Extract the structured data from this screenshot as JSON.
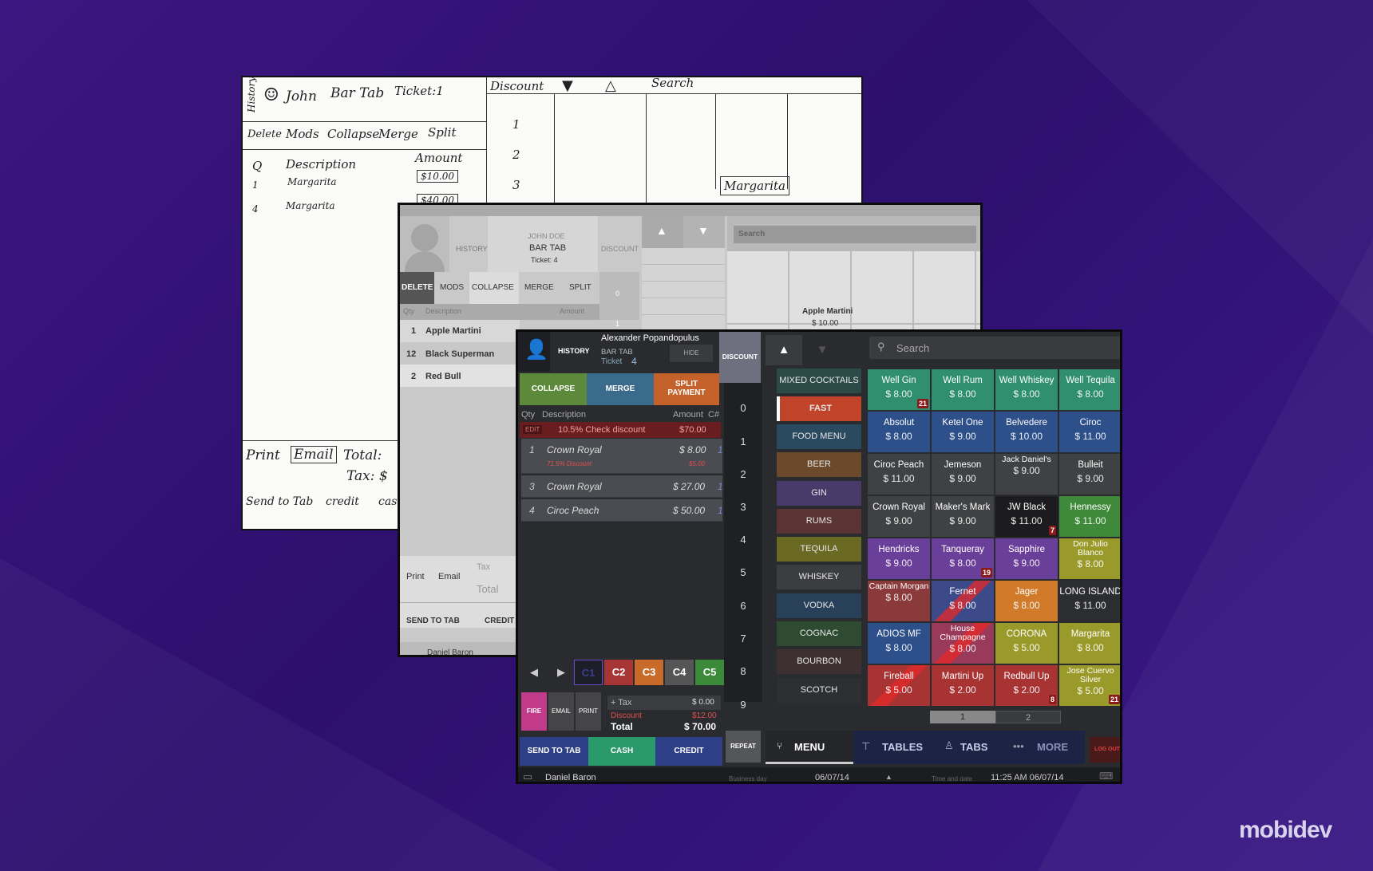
{
  "sketch": {
    "history": "History",
    "name": "John",
    "bar_tab": "Bar Tab",
    "ticket": "Ticket:1",
    "discount": "Discount",
    "search": "Search",
    "tabs": [
      "Delete",
      "Mods",
      "Collapse",
      "Merge",
      "Split"
    ],
    "col_q": "Q",
    "col_desc": "Description",
    "col_amount": "Amount",
    "rows": [
      {
        "q": "1",
        "desc": "Margarita",
        "amount": "$10.00"
      },
      {
        "q": "4",
        "desc": "Margarita",
        "amount": "$40.00"
      }
    ],
    "nums": [
      "1",
      "2",
      "3"
    ],
    "tile": "Margarita",
    "print": "Print",
    "email": "Email",
    "total": "Total:",
    "tax": "Tax: $",
    "send": "Send to Tab",
    "credit": "credit",
    "cash": "cas"
  },
  "wire": {
    "history": "HISTORY",
    "name": "JOHN DOE",
    "bar_tab": "BAR TAB",
    "ticket": "Ticket: 4",
    "discount": "DISCOUNT",
    "search": "Search",
    "tabs": [
      "DELETE",
      "MODS",
      "COLLAPSE",
      "MERGE",
      "SPLIT"
    ],
    "col_qty": "Qty",
    "col_desc": "Description",
    "col_amount": "Amount",
    "rows": [
      {
        "q": "1",
        "d": "Apple Martini"
      },
      {
        "q": "12",
        "d": "Black Superman"
      },
      {
        "q": "2",
        "d": "Red Bull"
      }
    ],
    "nums": [
      "0",
      "1"
    ],
    "tile_name": "Apple Martini",
    "tile_price": "$ 10.00",
    "print": "Print",
    "email": "Email",
    "tax": "Tax",
    "total": "Total",
    "send": "SEND TO TAB",
    "credit": "CREDIT",
    "user": "Daniel Baron"
  },
  "pos": {
    "history": "HISTORY",
    "customer": "Alexander Popandopulus",
    "bar_tab": "BAR TAB",
    "ticket_label": "Ticket",
    "ticket_num": "4",
    "hide": "HIDE",
    "discount": "DISCOUNT",
    "collapse": "COLLAPSE",
    "merge": "MERGE",
    "split": "SPLIT PAYMENT",
    "col_qty": "Qty",
    "col_desc": "Description",
    "col_amount": "Amount",
    "col_c": "C#",
    "disc_edit": "EDIT",
    "disc_text": "10.5%  Check discount",
    "disc_amount": "$70.00",
    "orders": [
      {
        "q": "1",
        "d": "Crown Royal",
        "a": "$ 8.00",
        "c": "1",
        "sub": "71.5%   Discount",
        "sub_a": "$5.00"
      },
      {
        "q": "3",
        "d": "Crown Royal",
        "a": "$ 27.00",
        "c": "1"
      },
      {
        "q": "4",
        "d": "Ciroc Peach",
        "a": "$ 50.00",
        "c": "1"
      }
    ],
    "nums": [
      "0",
      "1",
      "2",
      "3",
      "4",
      "5",
      "6",
      "7",
      "8",
      "9"
    ],
    "checks": [
      "C1",
      "C2",
      "C3",
      "C4",
      "C5"
    ],
    "fire": "FIRE",
    "email": "EMAIL",
    "print": "PRINT",
    "tax": "+ Tax",
    "tax_v": "$ 0.00",
    "discount_l": "Discount",
    "discount_v": "$12.00",
    "total": "Total",
    "total_v": "$ 70.00",
    "send": "SEND TO TAB",
    "cash": "CASH",
    "credit": "CREDIT",
    "repeat": "REPEAT",
    "search": "Search",
    "categories": [
      "MIXED COCKTAILS",
      "FAST",
      "FOOD MENU",
      "BEER",
      "GIN",
      "RUMS",
      "TEQUILA",
      "WHISKEY",
      "VODKA",
      "COGNAC",
      "BOURBON",
      "SCOTCH"
    ],
    "items": [
      {
        "n": "Well Gin",
        "p": "$ 8.00",
        "b": "21"
      },
      {
        "n": "Well Rum",
        "p": "$ 8.00"
      },
      {
        "n": "Well Whiskey",
        "p": "$ 8.00"
      },
      {
        "n": "Well Tequila",
        "p": "$ 8.00"
      },
      {
        "n": "Absolut",
        "p": "$ 8.00"
      },
      {
        "n": "Ketel One",
        "p": "$ 9.00"
      },
      {
        "n": "Belvedere",
        "p": "$ 10.00"
      },
      {
        "n": "Ciroc",
        "p": "$ 11.00"
      },
      {
        "n": "Ciroc Peach",
        "p": "$ 11.00"
      },
      {
        "n": "Jemeson",
        "p": "$ 9.00"
      },
      {
        "n": "Jack Daniel's",
        "p": "$ 9.00"
      },
      {
        "n": "Bulleit",
        "p": "$ 9.00"
      },
      {
        "n": "Crown Royal",
        "p": "$ 9.00"
      },
      {
        "n": "Maker's Mark",
        "p": "$ 9.00"
      },
      {
        "n": "JW Black",
        "p": "$ 11.00",
        "b": "7"
      },
      {
        "n": "Hennessy",
        "p": "$ 11.00"
      },
      {
        "n": "Hendricks",
        "p": "$ 9.00"
      },
      {
        "n": "Tanqueray",
        "p": "$ 8.00",
        "b": "19"
      },
      {
        "n": "Sapphire",
        "p": "$ 9.00"
      },
      {
        "n": "Don Julio Blanco",
        "p": "$ 8.00"
      },
      {
        "n": "Captain Morgan",
        "p": "$ 8.00"
      },
      {
        "n": "Fernet",
        "p": "$ 8.00"
      },
      {
        "n": "Jager",
        "p": "$ 8.00"
      },
      {
        "n": "LONG ISLAND",
        "p": "$ 11.00"
      },
      {
        "n": "ADIOS MF",
        "p": "$ 8.00"
      },
      {
        "n": "House Champagne",
        "p": "$ 8.00"
      },
      {
        "n": "CORONA",
        "p": "$ 5.00"
      },
      {
        "n": "Margarita",
        "p": "$ 8.00"
      },
      {
        "n": "Fireball",
        "p": "$ 5.00"
      },
      {
        "n": "Martini Up",
        "p": "$ 2.00"
      },
      {
        "n": "Redbull Up",
        "p": "$ 2.00",
        "b": "8"
      },
      {
        "n": "Jose Cuervo Silver",
        "p": "$ 5.00",
        "b": "21"
      }
    ],
    "pages": [
      "1",
      "2"
    ],
    "menu": "MENU",
    "tables": "TABLES",
    "tabs": "TABS",
    "more": "MORE",
    "logout": "LOG OUT",
    "user": "Daniel Baron",
    "bday_label": "Business day",
    "bday": "06/07/14",
    "time_label": "Time and date",
    "time": "11:25 AM 06/07/14"
  },
  "brand": "mobidev",
  "colors": {
    "bg": "#2d0f6e",
    "collapse": "#5a8a3a",
    "merge": "#3a6a8a",
    "split": "#c0622e",
    "fire": "#c23a8a",
    "cash": "#2a9a6a"
  }
}
